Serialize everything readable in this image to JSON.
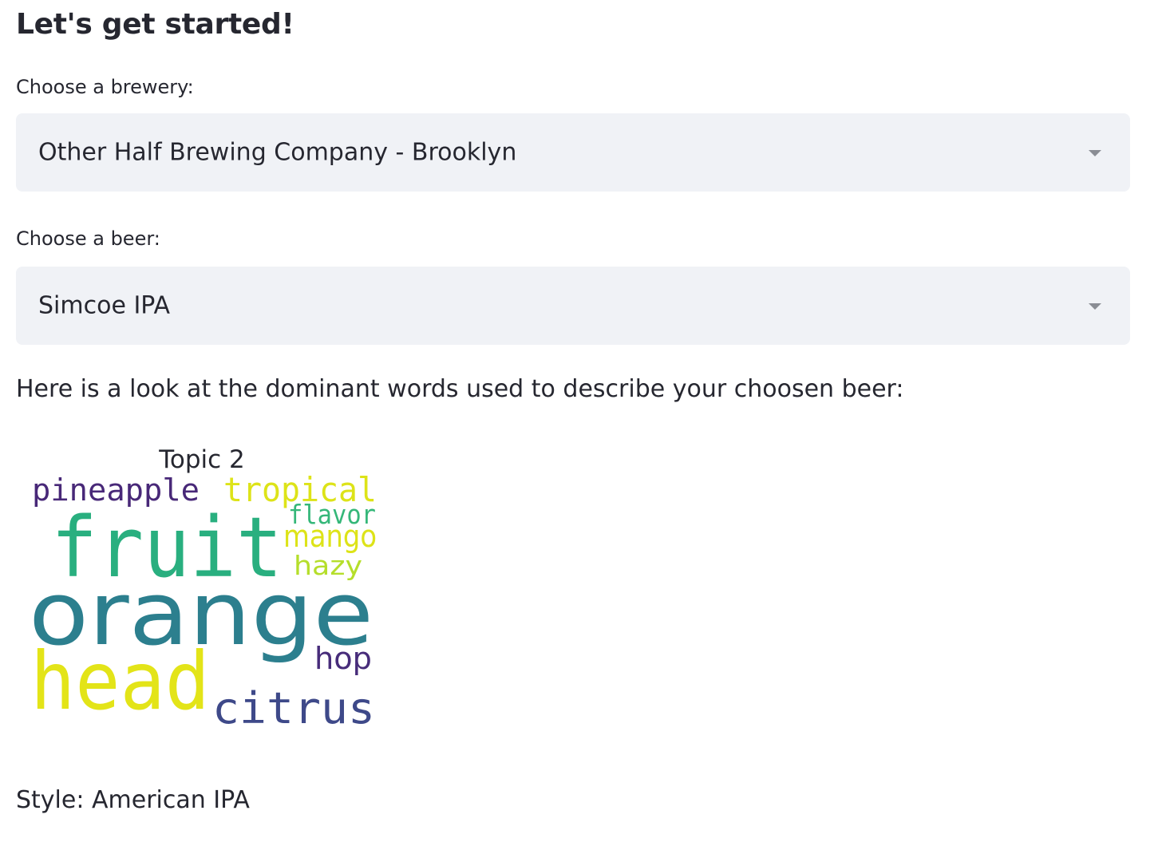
{
  "header": {
    "title": "Let's get started!"
  },
  "brewery_select": {
    "label": "Choose a brewery:",
    "value": "Other Half Brewing Company - Brooklyn",
    "icon": "chevron-down-icon"
  },
  "beer_select": {
    "label": "Choose a beer:",
    "value": "Simcoe IPA",
    "icon": "chevron-down-icon"
  },
  "description": {
    "text": "Here is a look at the dominant words used to describe your choosen beer:"
  },
  "wordcloud": {
    "title": "Topic 2",
    "words": [
      {
        "text": "pineapple",
        "color": "#482878"
      },
      {
        "text": "tropical",
        "color": "#dde318"
      },
      {
        "text": "flavor",
        "color": "#35b779"
      },
      {
        "text": "fruit",
        "color": "#29af7f"
      },
      {
        "text": "mango",
        "color": "#dde318"
      },
      {
        "text": "hazy",
        "color": "#b5de2b"
      },
      {
        "text": "orange",
        "color": "#2c7f8e"
      },
      {
        "text": "hop",
        "color": "#472c7a"
      },
      {
        "text": "head",
        "color": "#e3e418"
      },
      {
        "text": "citrus",
        "color": "#3e4989"
      }
    ]
  },
  "style_info": {
    "text": "Style: American IPA"
  }
}
